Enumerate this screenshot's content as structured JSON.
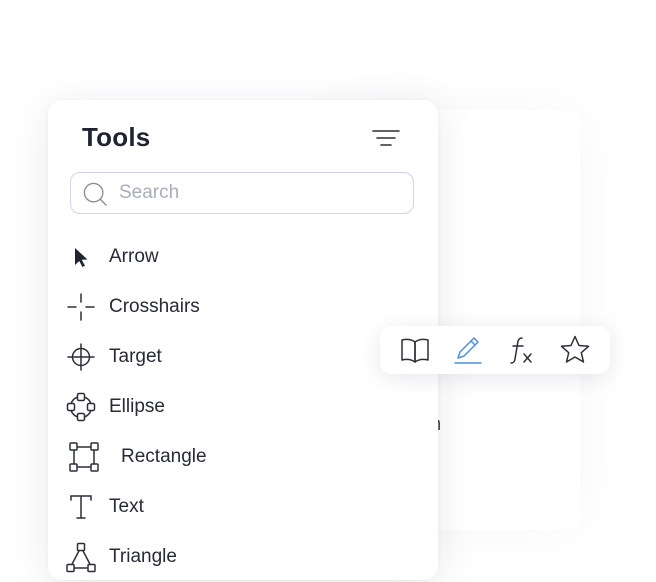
{
  "panel": {
    "title": "Tools",
    "filter_icon": "filter-lines-icon"
  },
  "search": {
    "placeholder": "Search",
    "value": "",
    "icon": "search-icon"
  },
  "tools": [
    {
      "label": "Arrow",
      "icon": "arrow-cursor-icon"
    },
    {
      "label": "Crosshairs",
      "icon": "crosshairs-icon"
    },
    {
      "label": "Target",
      "icon": "target-icon"
    },
    {
      "label": "Ellipse",
      "icon": "ellipse-icon"
    },
    {
      "label": "Rectangle",
      "icon": "rectangle-icon"
    },
    {
      "label": "Text",
      "icon": "text-icon"
    },
    {
      "label": "Triangle",
      "icon": "triangle-icon"
    }
  ],
  "toolbar": {
    "items": [
      {
        "icon": "book-icon",
        "active": false
      },
      {
        "icon": "pen-icon",
        "active": true
      },
      {
        "icon": "function-icon",
        "active": false
      },
      {
        "icon": "star-icon",
        "active": false
      }
    ],
    "active_color": "#4a90e2"
  },
  "background": {
    "partial_text": "on"
  },
  "colors": {
    "accent": "#4a90e2",
    "search_border": "#d5d1ee",
    "text": "#1f2430"
  }
}
